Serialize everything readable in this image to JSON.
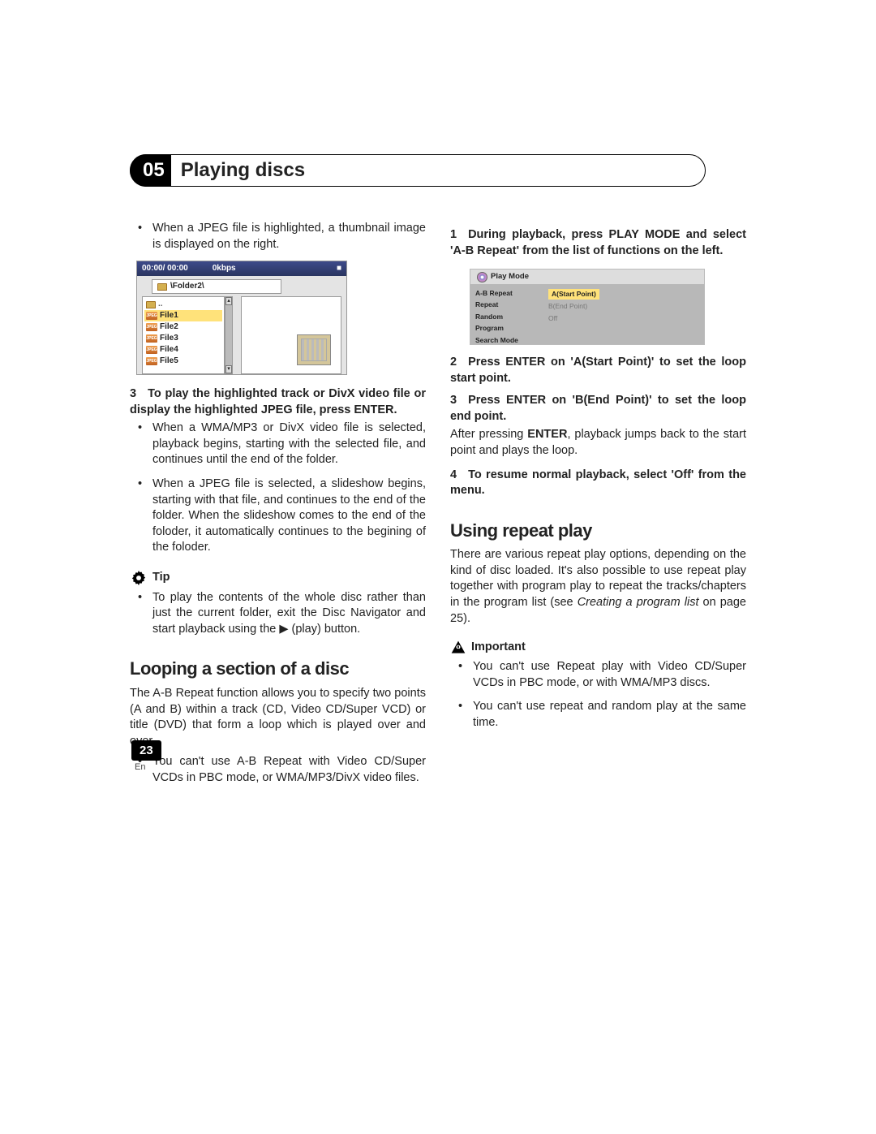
{
  "chapter": {
    "num": "05",
    "title": "Playing discs"
  },
  "left": {
    "intro_bullet": "When a JPEG file is highlighted, a thumbnail image is displayed on the right.",
    "nav": {
      "time": "00:00/ 00:00",
      "bitrate": "0kbps",
      "folder": "\\Folder2\\",
      "up": "..",
      "files": [
        "File1",
        "File2",
        "File3",
        "File4",
        "File5"
      ],
      "jpeg_badge": "JPEG"
    },
    "step3_heading_num": "3",
    "step3_heading": "To play the highlighted track or DivX video file or display the highlighted JPEG file, press ENTER.",
    "step3_b1": "When a WMA/MP3 or DivX video file is selected, playback begins, starting with the selected file, and continues until the end of the folder.",
    "step3_b2": "When a JPEG file is selected, a slideshow begins, starting with that file, and continues to the end of the folder. When the slideshow comes to the end of the foloder, it automatically continues to the begining of the foloder.",
    "tip_label": "Tip",
    "tip_text": "To play the contents of the whole disc rather than just the current folder, exit the Disc Navigator and start playback using the ▶ (play) button.",
    "looping_heading": "Looping a section of a disc",
    "looping_text": "The A-B Repeat function allows you to specify two points (A and B) within a track (CD, Video CD/Super VCD) or title (DVD) that form a loop which is played over and over.",
    "looping_b1": "You can't use A-B Repeat with Video CD/Super VCDs in PBC mode, or WMA/MP3/DivX video files."
  },
  "right": {
    "step1_num": "1",
    "step1": "During playback, press PLAY MODE and select 'A-B Repeat' from the list of functions on the left.",
    "pm": {
      "title": "Play Mode",
      "items": [
        "A-B Repeat",
        "Repeat",
        "Random",
        "Program",
        "Search Mode"
      ],
      "opts": [
        "A(Start Point)",
        "B(End Point)",
        "Off"
      ]
    },
    "step2_num": "2",
    "step2": "Press ENTER on 'A(Start Point)' to set the loop start point.",
    "step3_num": "3",
    "step3": "Press ENTER on 'B(End Point)' to set the loop end point.",
    "after_enter_1": "After pressing ",
    "after_enter_bold": "ENTER",
    "after_enter_2": ", playback jumps back to the start point and plays the loop.",
    "step4_num": "4",
    "step4": "To resume normal playback, select 'Off' from the menu.",
    "repeat_heading": "Using repeat play",
    "repeat_text_1": "There are various repeat play options, depending on the kind of disc loaded. It's also possible to use repeat play together with program play to repeat the tracks/chapters in the program list (see ",
    "repeat_text_italic": "Creating a program list",
    "repeat_text_2": " on page 25).",
    "important_label": "Important",
    "imp_b1": "You can't use Repeat play with Video CD/Super VCDs in PBC mode, or with WMA/MP3 discs.",
    "imp_b2": "You can't use repeat and random play at the same time."
  },
  "footer": {
    "pagenum": "23",
    "loc": "En"
  }
}
